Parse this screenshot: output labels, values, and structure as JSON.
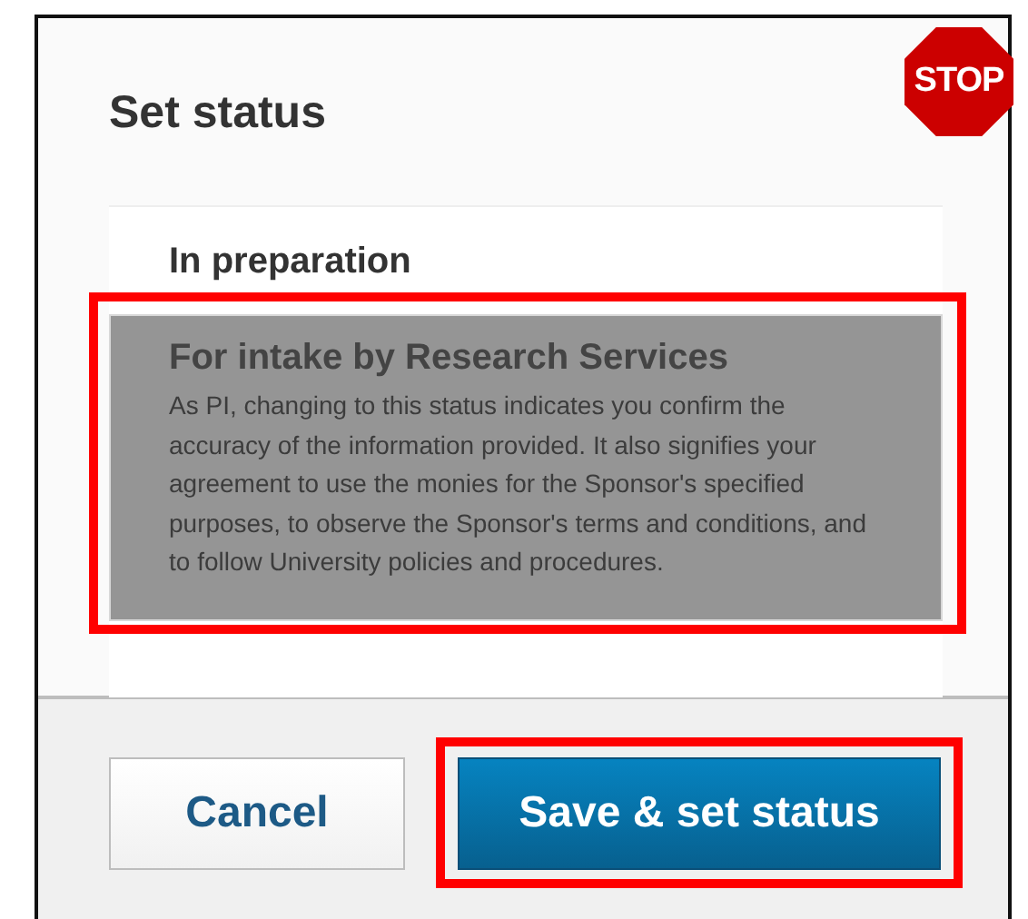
{
  "dialog": {
    "title": "Set status"
  },
  "stop_sign": {
    "label": "STOP"
  },
  "statuses": [
    {
      "title": "In preparation",
      "selected": false,
      "highlighted": false
    },
    {
      "title": "For intake by Research Services",
      "description": "As PI, changing to this status indicates you confirm the accuracy of the information provided. It also signifies your agreement to use the monies for the Sponsor's specified purposes, to observe the Sponsor's terms and conditions, and to follow University policies and procedures.",
      "selected": true,
      "highlighted": true
    }
  ],
  "buttons": [
    {
      "label": "Cancel",
      "kind": "secondary",
      "highlighted": false
    },
    {
      "label": "Save & set status",
      "kind": "primary",
      "highlighted": true
    }
  ]
}
